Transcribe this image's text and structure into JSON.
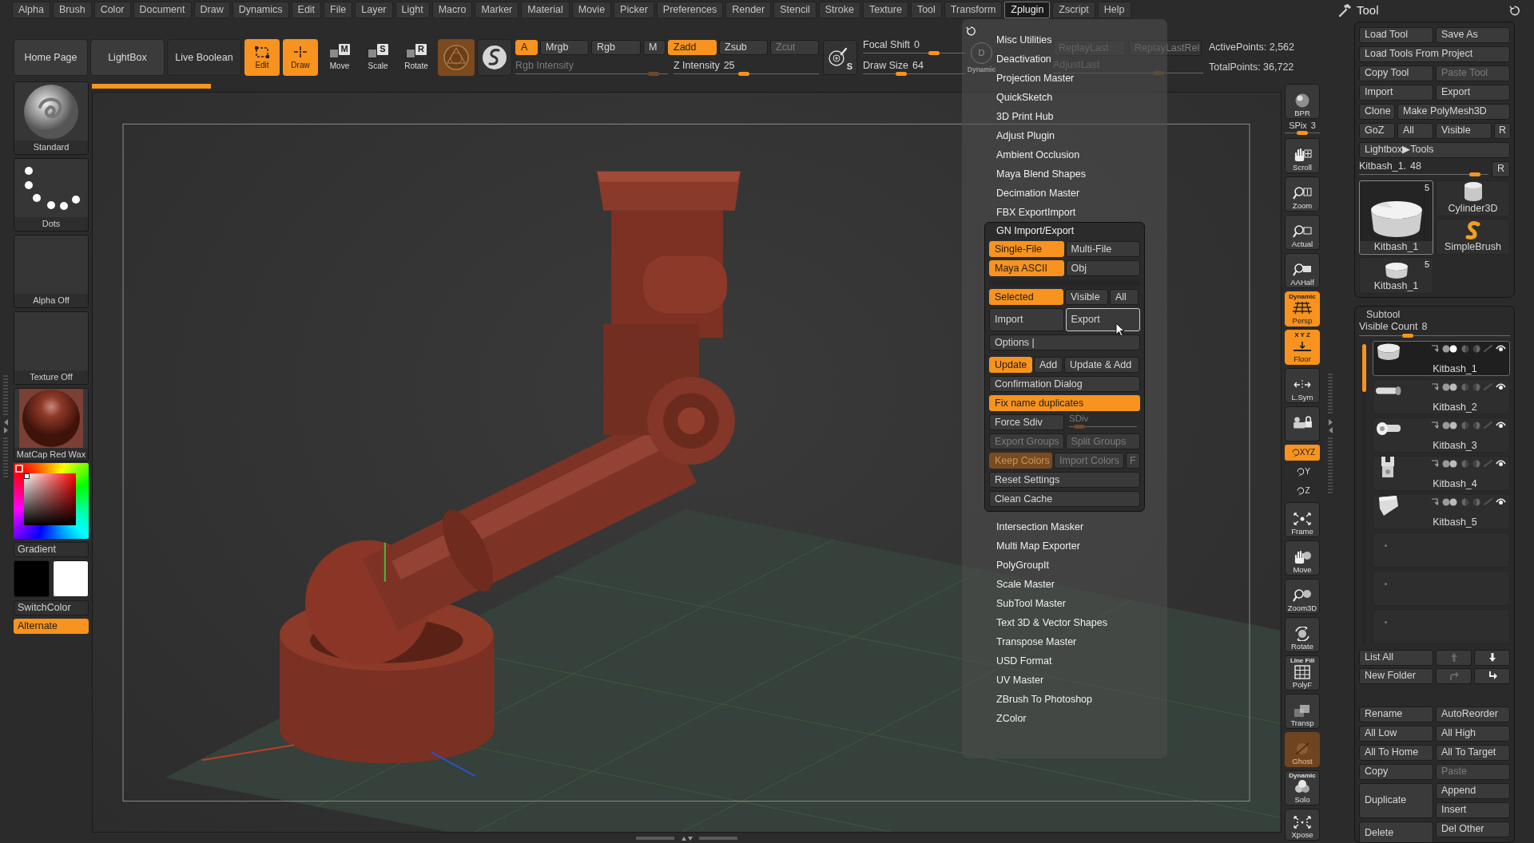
{
  "menu_bar": [
    {
      "label": "Alpha",
      "selected": false
    },
    {
      "label": "Brush",
      "selected": false
    },
    {
      "label": "Color",
      "selected": false
    },
    {
      "label": "Document",
      "selected": false
    },
    {
      "label": "Draw",
      "selected": false
    },
    {
      "label": "Dynamics",
      "selected": false
    },
    {
      "label": "Edit",
      "selected": false
    },
    {
      "label": "File",
      "selected": false
    },
    {
      "label": "Layer",
      "selected": false
    },
    {
      "label": "Light",
      "selected": false
    },
    {
      "label": "Macro",
      "selected": false
    },
    {
      "label": "Marker",
      "selected": false
    },
    {
      "label": "Material",
      "selected": false
    },
    {
      "label": "Movie",
      "selected": false
    },
    {
      "label": "Picker",
      "selected": false
    },
    {
      "label": "Preferences",
      "selected": false
    },
    {
      "label": "Render",
      "selected": false
    },
    {
      "label": "Stencil",
      "selected": false
    },
    {
      "label": "Stroke",
      "selected": false
    },
    {
      "label": "Texture",
      "selected": false
    },
    {
      "label": "Tool",
      "selected": false
    },
    {
      "label": "Transform",
      "selected": false
    },
    {
      "label": "Zplugin",
      "selected": true
    },
    {
      "label": "Zscript",
      "selected": false
    },
    {
      "label": "Help",
      "selected": false
    }
  ],
  "toolbar": {
    "nav_buttons": [
      {
        "kind": "button",
        "label": "Home Page"
      },
      {
        "kind": "button",
        "label": "LightBox"
      },
      {
        "kind": "toggle",
        "label": "Live Boolean"
      }
    ],
    "modes": [
      {
        "kind": "tool",
        "label": "Edit",
        "selected": true
      },
      {
        "kind": "tool",
        "label": "Draw",
        "selected": true
      },
      {
        "kind": "transform",
        "label": "Move",
        "key": "M",
        "selected": false
      },
      {
        "kind": "transform",
        "label": "Scale",
        "key": "S",
        "selected": false
      },
      {
        "kind": "transform",
        "label": "Rotate",
        "key": "R",
        "selected": false
      }
    ],
    "channels": [
      {
        "label": "A",
        "selected": true,
        "disabled": false
      },
      {
        "label": "Mrgb",
        "selected": false,
        "disabled": false
      },
      {
        "label": "Rgb",
        "selected": false,
        "disabled": false
      },
      {
        "label": "M",
        "selected": false,
        "disabled": false
      }
    ],
    "depth": [
      {
        "label": "Zadd",
        "selected": true,
        "disabled": false
      },
      {
        "label": "Zsub",
        "selected": false,
        "disabled": false
      },
      {
        "label": "Zcut",
        "selected": false,
        "disabled": true
      }
    ],
    "sliders": [
      {
        "label": "Rgb Intensity",
        "disabled": true,
        "level": 0.94
      },
      {
        "label": "Z Intensity",
        "value": "25",
        "disabled": false,
        "level": 0.48
      }
    ],
    "stroke_button": {
      "key": "S"
    },
    "brush_sliders": [
      {
        "label": "Focal Shift",
        "value": "0",
        "level": 0.71
      },
      {
        "label": "Draw Size",
        "value": "64",
        "level": 0.36
      }
    ],
    "dynamic": {
      "label": "Dynamic",
      "key": "D"
    },
    "replay_buttons": [
      {
        "label": "ReplayLast",
        "disabled": true
      },
      {
        "label": "ReplayLastRel",
        "disabled": true
      }
    ],
    "adjust_slider": {
      "label": "AdjustLast",
      "disabled": true,
      "level": 0.72
    },
    "stats": [
      "ActivePoints: 2,562",
      "TotalPoints: 36,722"
    ]
  },
  "progress": {
    "level": 0.1
  },
  "shelf": [
    {
      "kind": "brush",
      "label": "Standard"
    },
    {
      "kind": "stroke",
      "label": "Dots"
    },
    {
      "kind": "alpha",
      "label": "Alpha Off"
    },
    {
      "kind": "texture",
      "label": "Texture Off"
    },
    {
      "kind": "material",
      "label": "MatCap Red Wax"
    }
  ],
  "color_panel": {
    "gradient": "Gradient",
    "swatches": [
      {
        "color": "#000000"
      },
      {
        "color": "#ffffff"
      }
    ],
    "switch_color": "SwitchColor",
    "alternate": {
      "label": "Alternate",
      "selected": true
    }
  },
  "view_controls": [
    {
      "kind": "button",
      "label": "BPR",
      "selected": false,
      "disabled": false
    },
    {
      "kind": "slider",
      "label": "SPix",
      "value": "3",
      "level": 0.5
    },
    {
      "kind": "button",
      "label": "Scroll",
      "selected": false,
      "disabled": false
    },
    {
      "kind": "button",
      "label": "Zoom",
      "selected": false,
      "disabled": false
    },
    {
      "kind": "button",
      "label": "Actual",
      "selected": false,
      "disabled": false
    },
    {
      "kind": "button",
      "label": "AAHalf",
      "selected": false,
      "disabled": false
    },
    {
      "kind": "button",
      "label": "Persp",
      "caption": "Dynamic",
      "selected": true,
      "disabled": false
    },
    {
      "kind": "button",
      "label": "Floor",
      "caption": "X Y Z",
      "selected": true,
      "disabled": false
    },
    {
      "kind": "button",
      "label": "L.Sym",
      "selected": false,
      "disabled": false
    },
    {
      "kind": "icon",
      "selected": false,
      "disabled": false
    },
    {
      "kind": "small",
      "label": "XYZ",
      "selected": true,
      "disabled": false
    },
    {
      "kind": "small",
      "label": "Y",
      "selected": false,
      "disabled": false
    },
    {
      "kind": "small",
      "label": "Z",
      "selected": false,
      "disabled": false
    },
    {
      "kind": "button",
      "label": "Frame",
      "selected": false,
      "disabled": false
    },
    {
      "kind": "button",
      "label": "Move",
      "selected": false,
      "disabled": false
    },
    {
      "kind": "button",
      "label": "Zoom3D",
      "selected": false,
      "disabled": false
    },
    {
      "kind": "button",
      "label": "Rotate",
      "selected": false,
      "disabled": false
    },
    {
      "kind": "button",
      "label": "PolyF",
      "caption": "Line Fill",
      "selected": false,
      "disabled": false
    },
    {
      "kind": "button",
      "label": "Transp",
      "selected": false,
      "disabled": false
    },
    {
      "kind": "button",
      "label": "Ghost",
      "selected": true,
      "disabled": true
    },
    {
      "kind": "button",
      "label": "Solo",
      "caption": "Dynamic",
      "selected": false,
      "disabled": false
    },
    {
      "kind": "button",
      "label": "Xpose",
      "selected": false,
      "disabled": false
    }
  ],
  "zplugin_menu": {
    "items": [
      {
        "kind": "item",
        "label": "Misc Utilities"
      },
      {
        "kind": "item",
        "label": "Deactivation"
      },
      {
        "kind": "item",
        "label": "Projection Master"
      },
      {
        "kind": "item",
        "label": "QuickSketch"
      },
      {
        "kind": "item",
        "label": "3D Print Hub"
      },
      {
        "kind": "item",
        "label": "Adjust Plugin"
      },
      {
        "kind": "item",
        "label": "Ambient Occlusion"
      },
      {
        "kind": "item",
        "label": "Maya Blend Shapes"
      },
      {
        "kind": "item",
        "label": "Decimation Master"
      },
      {
        "kind": "item",
        "label": "FBX ExportImport"
      },
      {
        "kind": "panel",
        "title": "GN Import/Export",
        "rows": [
          [
            {
              "label": "Single-File",
              "selected": true,
              "disabled": false,
              "hovered": false
            },
            {
              "label": "Multi-File",
              "selected": false,
              "disabled": false,
              "hovered": false
            }
          ],
          [
            {
              "label": "Maya ASCII",
              "selected": true,
              "disabled": false,
              "hovered": false
            },
            {
              "label": "Obj",
              "selected": false,
              "disabled": false,
              "hovered": false
            }
          ],
          [
            {
              "label": "Selected",
              "selected": true,
              "disabled": false,
              "hovered": false
            },
            {
              "label": "Visible",
              "selected": false,
              "disabled": false,
              "hovered": false
            },
            {
              "label": "All",
              "selected": false,
              "disabled": false,
              "hovered": false
            }
          ],
          [
            {
              "label": "Import",
              "selected": false,
              "disabled": false,
              "hovered": false
            },
            {
              "label": "Export",
              "selected": false,
              "disabled": false,
              "hovered": true
            }
          ],
          [
            {
              "label": "Options |",
              "selected": false,
              "disabled": false,
              "hovered": false
            }
          ],
          [
            {
              "label": "Update",
              "selected": true,
              "disabled": false,
              "hovered": false
            },
            {
              "label": "Add",
              "selected": false,
              "disabled": false,
              "hovered": false
            },
            {
              "label": "Update & Add",
              "selected": false,
              "disabled": false,
              "hovered": false
            }
          ],
          [
            {
              "label": "Confirmation Dialog",
              "selected": false,
              "disabled": false,
              "hovered": false
            }
          ],
          [
            {
              "label": "Fix name duplicates",
              "selected": true,
              "disabled": false,
              "hovered": false
            }
          ],
          [
            {
              "kind": "button",
              "label": "Force Sdiv",
              "selected": false,
              "disabled": false,
              "hovered": false
            },
            {
              "kind": "slider",
              "label": "SDiv",
              "disabled": true,
              "level": 0.08
            }
          ],
          [
            {
              "label": "Export Groups",
              "selected": false,
              "disabled": true,
              "hovered": false
            },
            {
              "label": "Split Groups",
              "selected": false,
              "disabled": true,
              "hovered": false
            }
          ],
          [
            {
              "label": "Keep Colors",
              "selected": true,
              "disabled": true,
              "hovered": false
            },
            {
              "label": "Import Colors",
              "selected": false,
              "disabled": true,
              "hovered": false
            },
            {
              "label": "F",
              "selected": false,
              "disabled": true,
              "hovered": false
            }
          ],
          [
            {
              "label": "Reset Settings",
              "selected": false,
              "disabled": false,
              "hovered": false
            }
          ],
          [
            {
              "label": "Clean Cache",
              "selected": false,
              "disabled": false,
              "hovered": false
            }
          ]
        ]
      },
      {
        "kind": "item",
        "label": "Intersection Masker"
      },
      {
        "kind": "item",
        "label": "Multi Map Exporter"
      },
      {
        "kind": "item",
        "label": "PolyGroupIt"
      },
      {
        "kind": "item",
        "label": "Scale Master"
      },
      {
        "kind": "item",
        "label": "SubTool Master"
      },
      {
        "kind": "item",
        "label": "Text 3D & Vector Shapes"
      },
      {
        "kind": "item",
        "label": "Transpose Master"
      },
      {
        "kind": "item",
        "label": "USD Format"
      },
      {
        "kind": "item",
        "label": "UV Master"
      },
      {
        "kind": "item",
        "label": "ZBrush To Photoshop"
      },
      {
        "kind": "item",
        "label": "ZColor"
      }
    ]
  },
  "tool_panel": {
    "title": "Tool",
    "rows": [
      [
        {
          "label": "Load Tool",
          "disabled": false
        },
        {
          "label": "Save As",
          "disabled": false
        }
      ],
      [
        {
          "label": "Load Tools From Project",
          "disabled": false
        }
      ],
      [
        {
          "label": "Copy Tool",
          "disabled": false
        },
        {
          "label": "Paste Tool",
          "disabled": true
        }
      ],
      [
        {
          "label": "Import",
          "disabled": false
        },
        {
          "label": "Export",
          "disabled": false
        }
      ],
      [
        {
          "label": "Clone",
          "disabled": false
        },
        {
          "label": "Make PolyMesh3D",
          "disabled": false
        }
      ],
      [
        {
          "label": "GoZ",
          "disabled": false
        },
        {
          "label": "All",
          "disabled": false
        },
        {
          "label": "Visible",
          "disabled": false
        },
        {
          "label": "R",
          "disabled": false
        }
      ],
      [
        {
          "label": "Lightbox▶Tools",
          "disabled": false
        }
      ]
    ],
    "slider": {
      "label": "Kitbash_1.",
      "value": "48",
      "level": 0.93
    },
    "slider_button": "R",
    "tools": [
      {
        "label": "Kitbash_1",
        "count": "5",
        "selected": true
      },
      {
        "label": "Cylinder3D",
        "selected": false
      },
      {
        "label": "SimpleBrush",
        "selected": false
      },
      {
        "label": "Kitbash_1",
        "count": "5",
        "selected": false
      }
    ]
  },
  "subtool_panel": {
    "title": "Subtool",
    "visible_count": {
      "label": "Visible Count",
      "value": "8",
      "level": 0.31
    },
    "subtools": [
      {
        "kind": "subtool",
        "name": "Kitbash_1",
        "selected": true,
        "visible": true
      },
      {
        "kind": "subtool",
        "name": "Kitbash_2",
        "selected": false,
        "visible": true
      },
      {
        "kind": "subtool",
        "name": "Kitbash_3",
        "selected": false,
        "visible": true
      },
      {
        "kind": "subtool",
        "name": "Kitbash_4",
        "selected": false,
        "visible": true
      },
      {
        "kind": "subtool",
        "name": "Kitbash_5",
        "selected": false,
        "visible": true
      },
      {
        "kind": "empty",
        "selected": false
      },
      {
        "kind": "empty",
        "selected": false
      },
      {
        "kind": "empty",
        "selected": false
      }
    ],
    "list_buttons": [
      {
        "label": "List All",
        "disabled": false
      },
      {
        "disabled": true
      },
      {
        "disabled": false
      },
      {
        "label": "New Folder",
        "disabled": false
      },
      {
        "disabled": true
      },
      {
        "disabled": false
      }
    ],
    "action_columns": [
      [
        {
          "kind": "normal",
          "label": "Rename",
          "disabled": false
        },
        {
          "kind": "normal",
          "label": "All Low",
          "disabled": false
        },
        {
          "kind": "normal",
          "label": "All To Home",
          "disabled": false
        },
        {
          "kind": "normal",
          "label": "Copy",
          "disabled": false
        },
        {
          "kind": "tall",
          "label": "Duplicate",
          "disabled": false
        },
        {
          "kind": "tall",
          "label": "Delete",
          "disabled": false
        }
      ],
      [
        {
          "kind": "normal",
          "label": "AutoReorder",
          "disabled": false
        },
        {
          "kind": "normal",
          "label": "All High",
          "disabled": false
        },
        {
          "kind": "normal",
          "label": "All To Target",
          "disabled": false
        },
        {
          "kind": "normal",
          "label": "Paste",
          "disabled": true
        },
        {
          "kind": "normal",
          "label": "Append",
          "disabled": false
        },
        {
          "kind": "normal",
          "label": "Insert",
          "disabled": false
        },
        {
          "kind": "normal",
          "label": "Del Other",
          "disabled": false
        }
      ]
    ]
  }
}
